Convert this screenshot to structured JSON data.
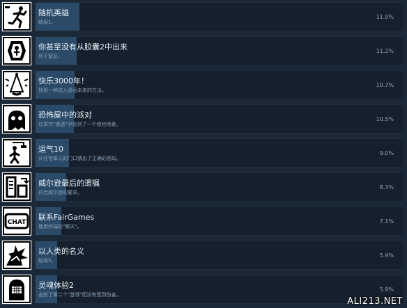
{
  "achievements": [
    {
      "title": "随机英雄",
      "desc": "结局1。",
      "percent": "11.9%",
      "fill": 0.119,
      "icon": "running-figure-icon"
    },
    {
      "title": "你甚至没有从胶囊2中出来",
      "desc": "死于窒息。",
      "percent": "11.2%",
      "fill": 0.112,
      "icon": "capsule-icon"
    },
    {
      "title": "快乐3000年！",
      "desc": "找到一种进入遥远未来的方法。",
      "percent": "10.7%",
      "fill": 0.107,
      "icon": "party-hat-icon"
    },
    {
      "title": "恐怖屋中的派对",
      "desc": "在章节\"渗透\"中找到了一个惊险场景。",
      "percent": "10.5%",
      "fill": 0.105,
      "icon": "ghost-figure-icon"
    },
    {
      "title": "运气10",
      "desc": "从住宅单元的门口猜出了正确的密码。",
      "percent": "9.0%",
      "fill": 0.09,
      "icon": "falling-figure-icon"
    },
    {
      "title": "威尔逊最后的遗嘱",
      "desc": "符合威尔逊的要求。",
      "percent": "8.3%",
      "fill": 0.083,
      "icon": "document-tablet-icon"
    },
    {
      "title": "联系FairGames",
      "desc": "使用终端的\"聊天\"。",
      "percent": "7.1%",
      "fill": 0.071,
      "icon": "chat-icon"
    },
    {
      "title": "以人类的名义",
      "desc": "结局5。",
      "percent": "5.9%",
      "fill": 0.059,
      "icon": "explosion-icon"
    },
    {
      "title": "灵魂体验2",
      "desc": "击败了第二个\"首领\"而没有受到伤害。",
      "percent": "5.9%",
      "fill": 0.059,
      "icon": "helmet-icon"
    }
  ],
  "watermark": "ALI213.NET"
}
